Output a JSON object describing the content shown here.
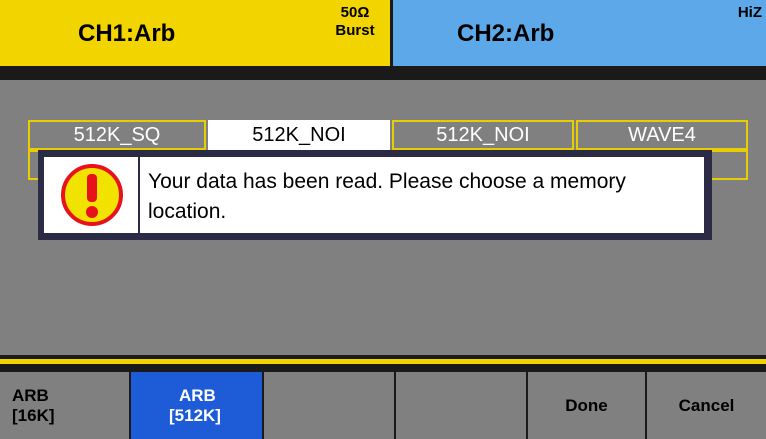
{
  "header": {
    "ch1": {
      "title": "CH1:Arb",
      "impedance": "50Ω",
      "mode": "Burst"
    },
    "ch2": {
      "title": "CH2:Arb",
      "impedance": "HiZ"
    }
  },
  "memory": {
    "row1": [
      "512K_SQ",
      "512K_NOI",
      "512K_NOI",
      "WAVE4"
    ]
  },
  "dialog": {
    "message": "Your data has been read. Please choose a memory location.",
    "icon": "warning-icon"
  },
  "softkeys": [
    {
      "l1": "ARB",
      "l2": "[16K]"
    },
    {
      "l1": "ARB",
      "l2": "[512K]"
    },
    {
      "l1": ""
    },
    {
      "l1": ""
    },
    {
      "l1": "Done"
    },
    {
      "l1": "Cancel"
    }
  ],
  "colors": {
    "ch1": "#f2d400",
    "ch2": "#5ca8e8",
    "active_key": "#1d5cd6",
    "warning": "#e8121a"
  }
}
